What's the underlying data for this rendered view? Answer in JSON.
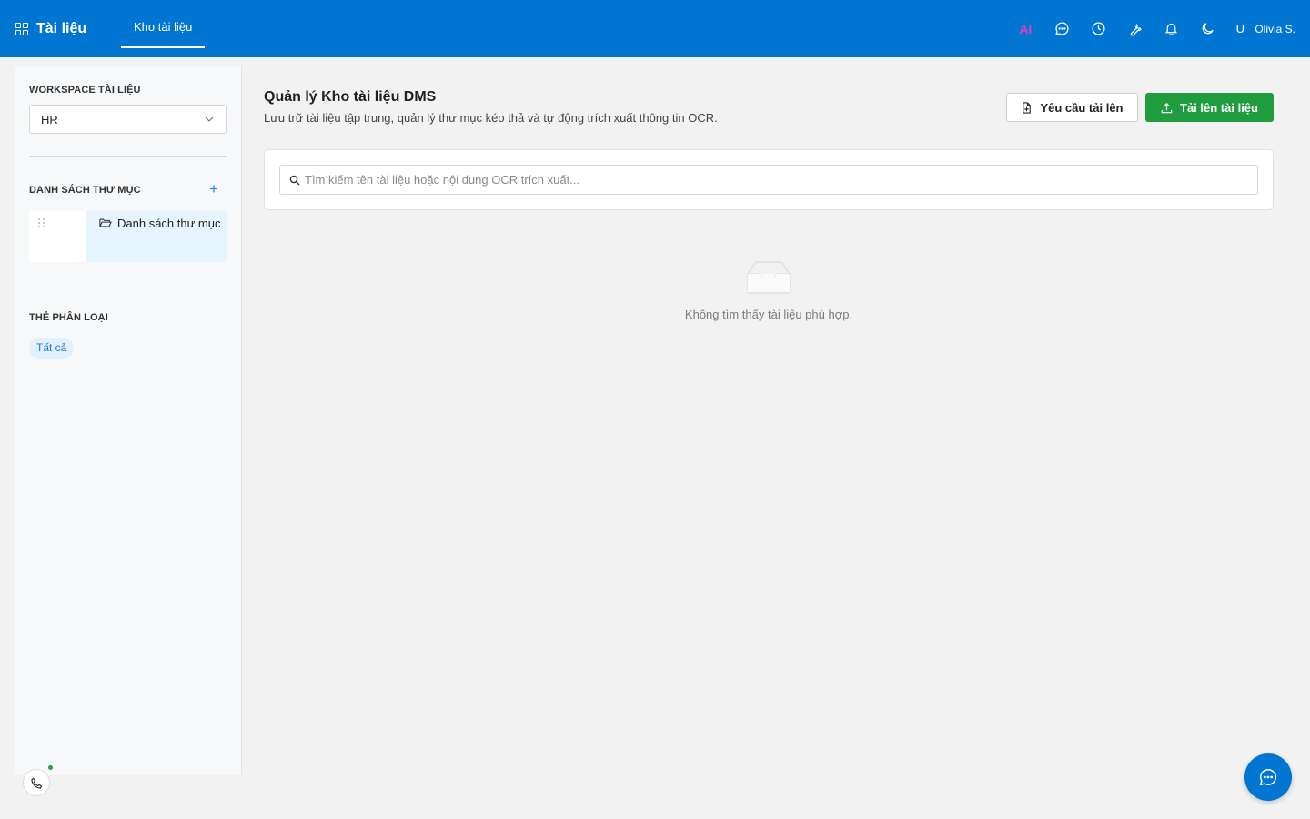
{
  "header": {
    "app_title": "Tài liệu",
    "tabs": [
      {
        "label": "Kho tài liệu",
        "active": true
      }
    ],
    "ai_label": "AI",
    "user_initial": "U",
    "user_name": "Olivia S.",
    "icons": [
      "apps-grid-icon",
      "chat-icon",
      "clock-icon",
      "wrench-icon",
      "bell-icon",
      "moon-icon"
    ]
  },
  "sidebar": {
    "workspace_label": "WORKSPACE TÀI LIỆU",
    "workspace_value": "HR",
    "folders_label": "DANH SÁCH THƯ MỤC",
    "add_symbol": "+",
    "folders": [
      {
        "label": "Danh sách thư mục"
      }
    ],
    "tags_label": "THẺ PHÂN LOẠI",
    "tags": [
      {
        "label": "Tất cả",
        "active": true
      }
    ]
  },
  "main": {
    "title": "Quản lý Kho tài liệu DMS",
    "subtitle": "Lưu trữ tài liệu tập trung, quản lý thư mục kéo thả và tự động trích xuất thông tin OCR.",
    "request_button": "Yêu cầu tải lên",
    "upload_button": "Tải lên tài liệu",
    "search_placeholder": "Tìm kiếm tên tài liệu hoặc nội dung OCR trích xuất...",
    "empty_text": "Không tìm thấy tài liệu phù hợp."
  },
  "colors": {
    "brand_blue": "#0175d2",
    "upload_green": "#1f9d3e",
    "tag_blue": "#1d7fd1",
    "status_green": "#20a346"
  }
}
